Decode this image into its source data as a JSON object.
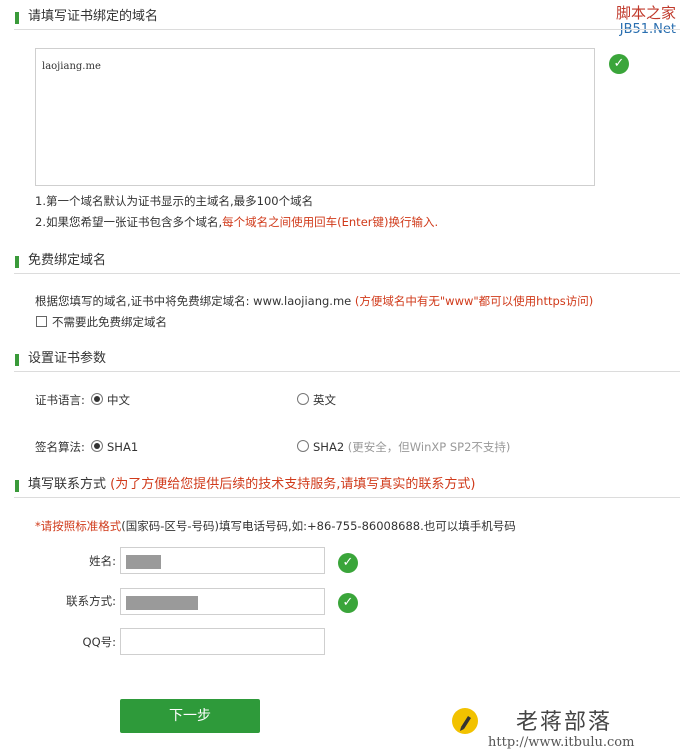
{
  "watermark_top": {
    "line1": "脚本之家",
    "line2": "JB51.Net"
  },
  "section_domain": {
    "title": "请填写证书绑定的域名",
    "textarea_value": "laojiang.me",
    "hint1": "1.第一个域名默认为证书显示的主域名,最多100个域名",
    "hint2_prefix": "2.如果您希望一张证书包含多个域名,",
    "hint2_red": "每个域名之间使用回车(Enter键)换行输入."
  },
  "section_free": {
    "title": "免费绑定域名",
    "desc_prefix": "根据您填写的域名,证书中将免费绑定域名: www.laojiang.me",
    "desc_red": " (方便域名中有无\"www\"都可以使用https访问)",
    "checkbox_label": "不需要此免费绑定域名",
    "checkbox_checked": false
  },
  "section_params": {
    "title": "设置证书参数",
    "lang_label": "证书语言:",
    "lang_opt1": "中文",
    "lang_opt2": "英文",
    "lang_selected": "中文",
    "algo_label": "签名算法:",
    "algo_opt1": "SHA1",
    "algo_opt2": "SHA2",
    "algo_opt2_note": "(更安全，但WinXP SP2不支持)",
    "algo_selected": "SHA1"
  },
  "section_contact": {
    "title": "填写联系方式",
    "title_note": "(为了方便给您提供后续的技术支持服务,请填写真实的联系方式)",
    "hint_red": "*请按照标准格式",
    "hint_rest": "(国家码-区号-号码)填写电话号码,如:+86-755-86008688.也可以填手机号码",
    "name_label": "姓名:",
    "phone_label": "联系方式:",
    "qq_label": "QQ号:",
    "name_value": "",
    "phone_value": "",
    "qq_value": ""
  },
  "next_button": "下一步",
  "watermark_bottom": {
    "name": "老蒋部落",
    "url": "http://www.itbulu.com"
  },
  "colors": {
    "accent_green": "#2e9a3a",
    "check_green": "#3aa53a",
    "warning_red": "#d03a1a"
  }
}
